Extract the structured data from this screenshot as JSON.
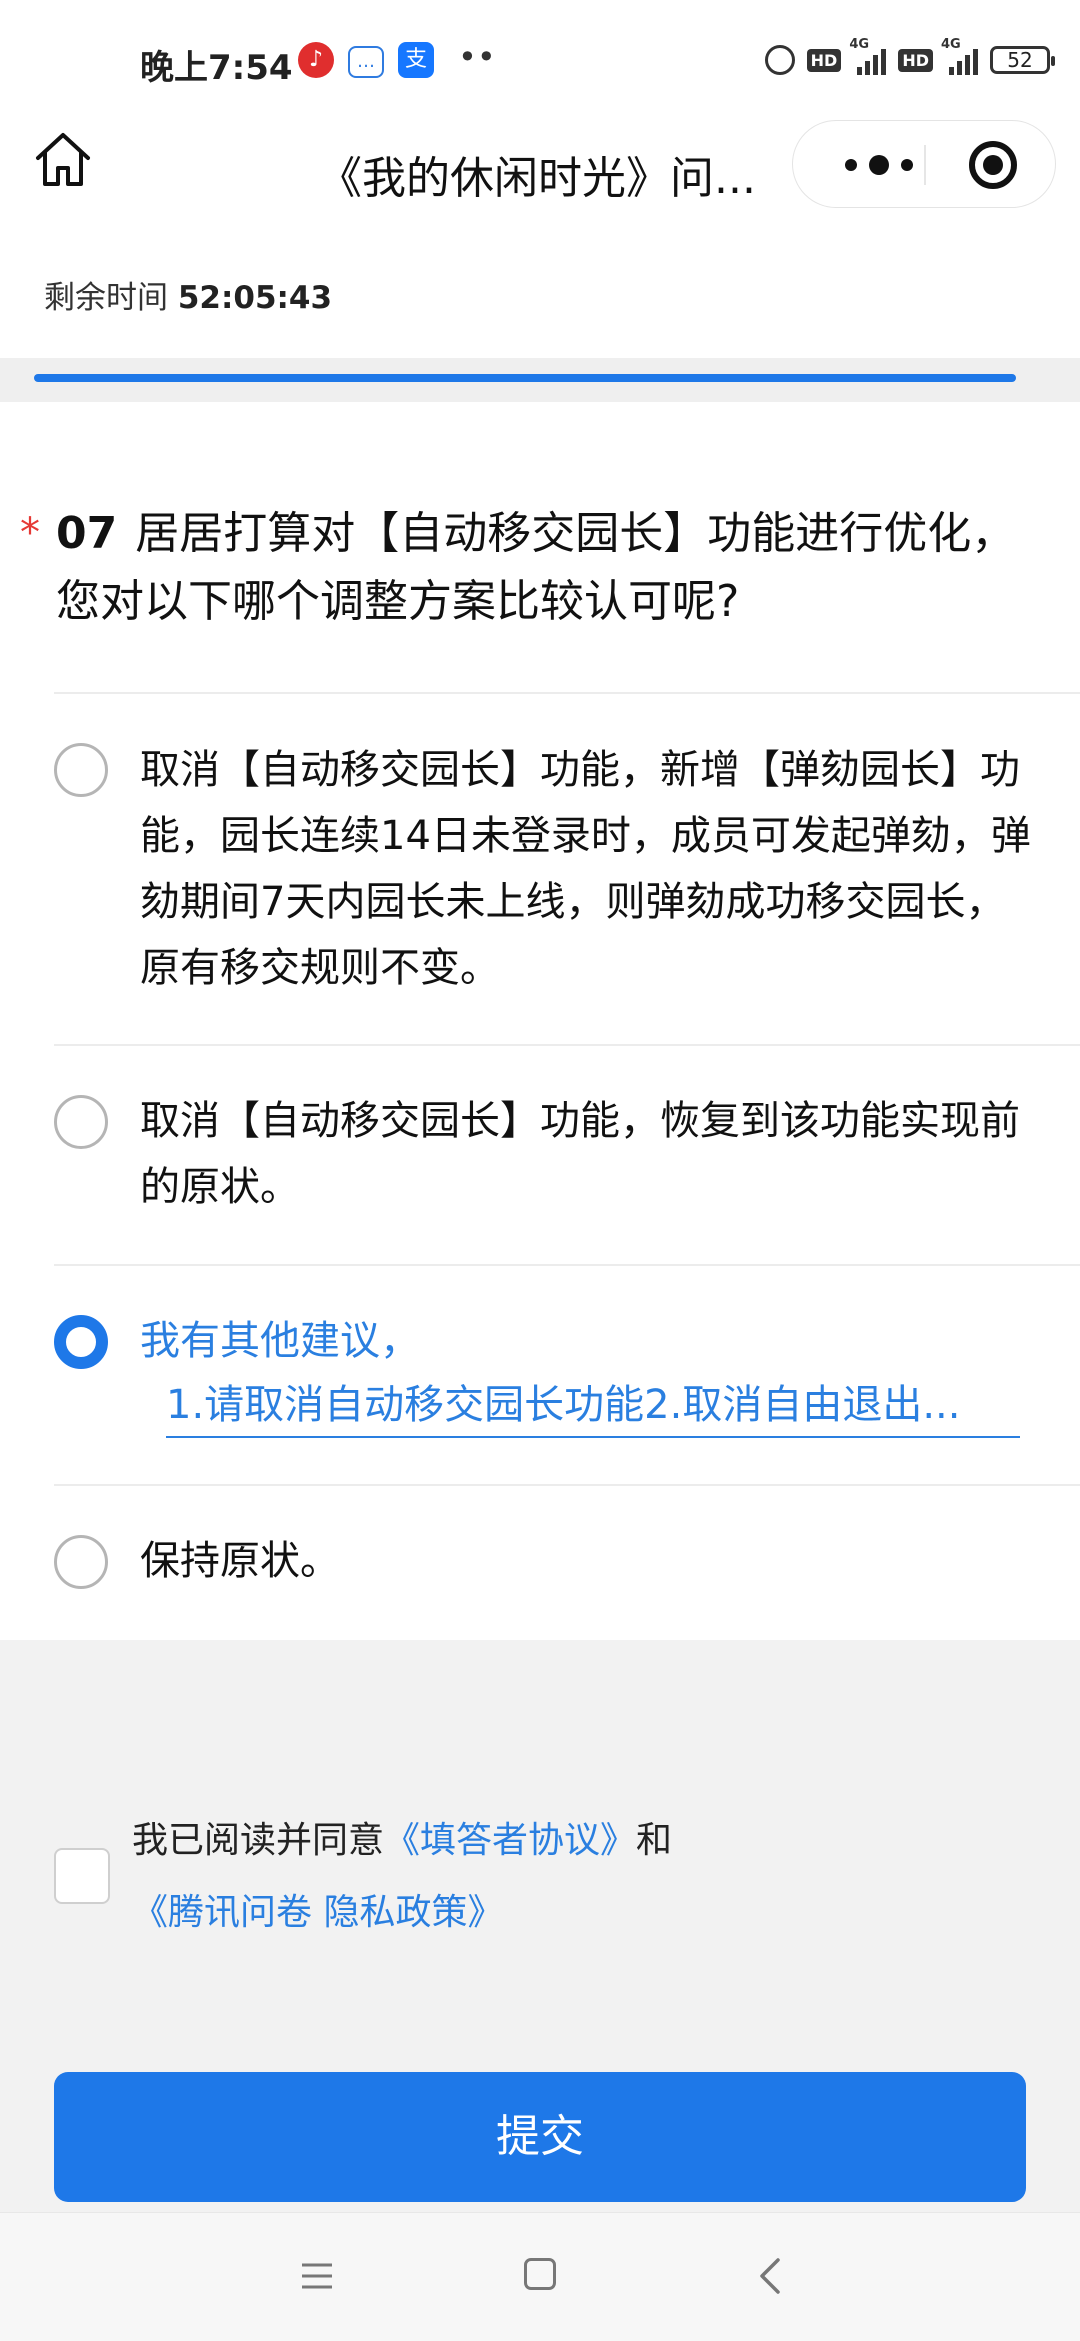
{
  "status_bar": {
    "time": "晚上7:54",
    "more": "••",
    "hd1": "HD",
    "net1": "4G",
    "hd2": "HD",
    "net2": "4G",
    "battery": "52"
  },
  "nav": {
    "title": "《我的休闲时光》问..."
  },
  "timer": {
    "label": "剩余时间",
    "value": "52:05:43"
  },
  "progress": {
    "fraction": 0.97,
    "color": "#1e78e8"
  },
  "question": {
    "required_mark": "*",
    "number": "07",
    "text": "居居打算对【自动移交园长】功能进行优化，您对以下哪个调整方案比较认可呢?",
    "options": [
      {
        "label": "取消【自动移交园长】功能，新增【弹劾园长】功能，园长连续14日未登录时，成员可发起弹劾，弹劾期间7天内园长未上线，则弹劾成功移交园长，原有移交规则不变。",
        "selected": false
      },
      {
        "label": "取消【自动移交园长】功能，恢复到该功能实现前的原状。",
        "selected": false
      },
      {
        "label": "我有其他建议，",
        "selected": true,
        "input_value": "1.请取消自动移交园长功能2.取消自由退出..."
      },
      {
        "label": "保持原状。",
        "selected": false
      }
    ]
  },
  "agreement": {
    "prefix": "我已阅读并同意",
    "link1": "《填答者协议》",
    "mid": "和",
    "link2": "《腾讯问卷 隐私政策》",
    "checked": false
  },
  "submit": {
    "label": "提交"
  },
  "colors": {
    "accent": "#1e78e8",
    "link": "#2a7fe0",
    "required": "#e53935"
  }
}
